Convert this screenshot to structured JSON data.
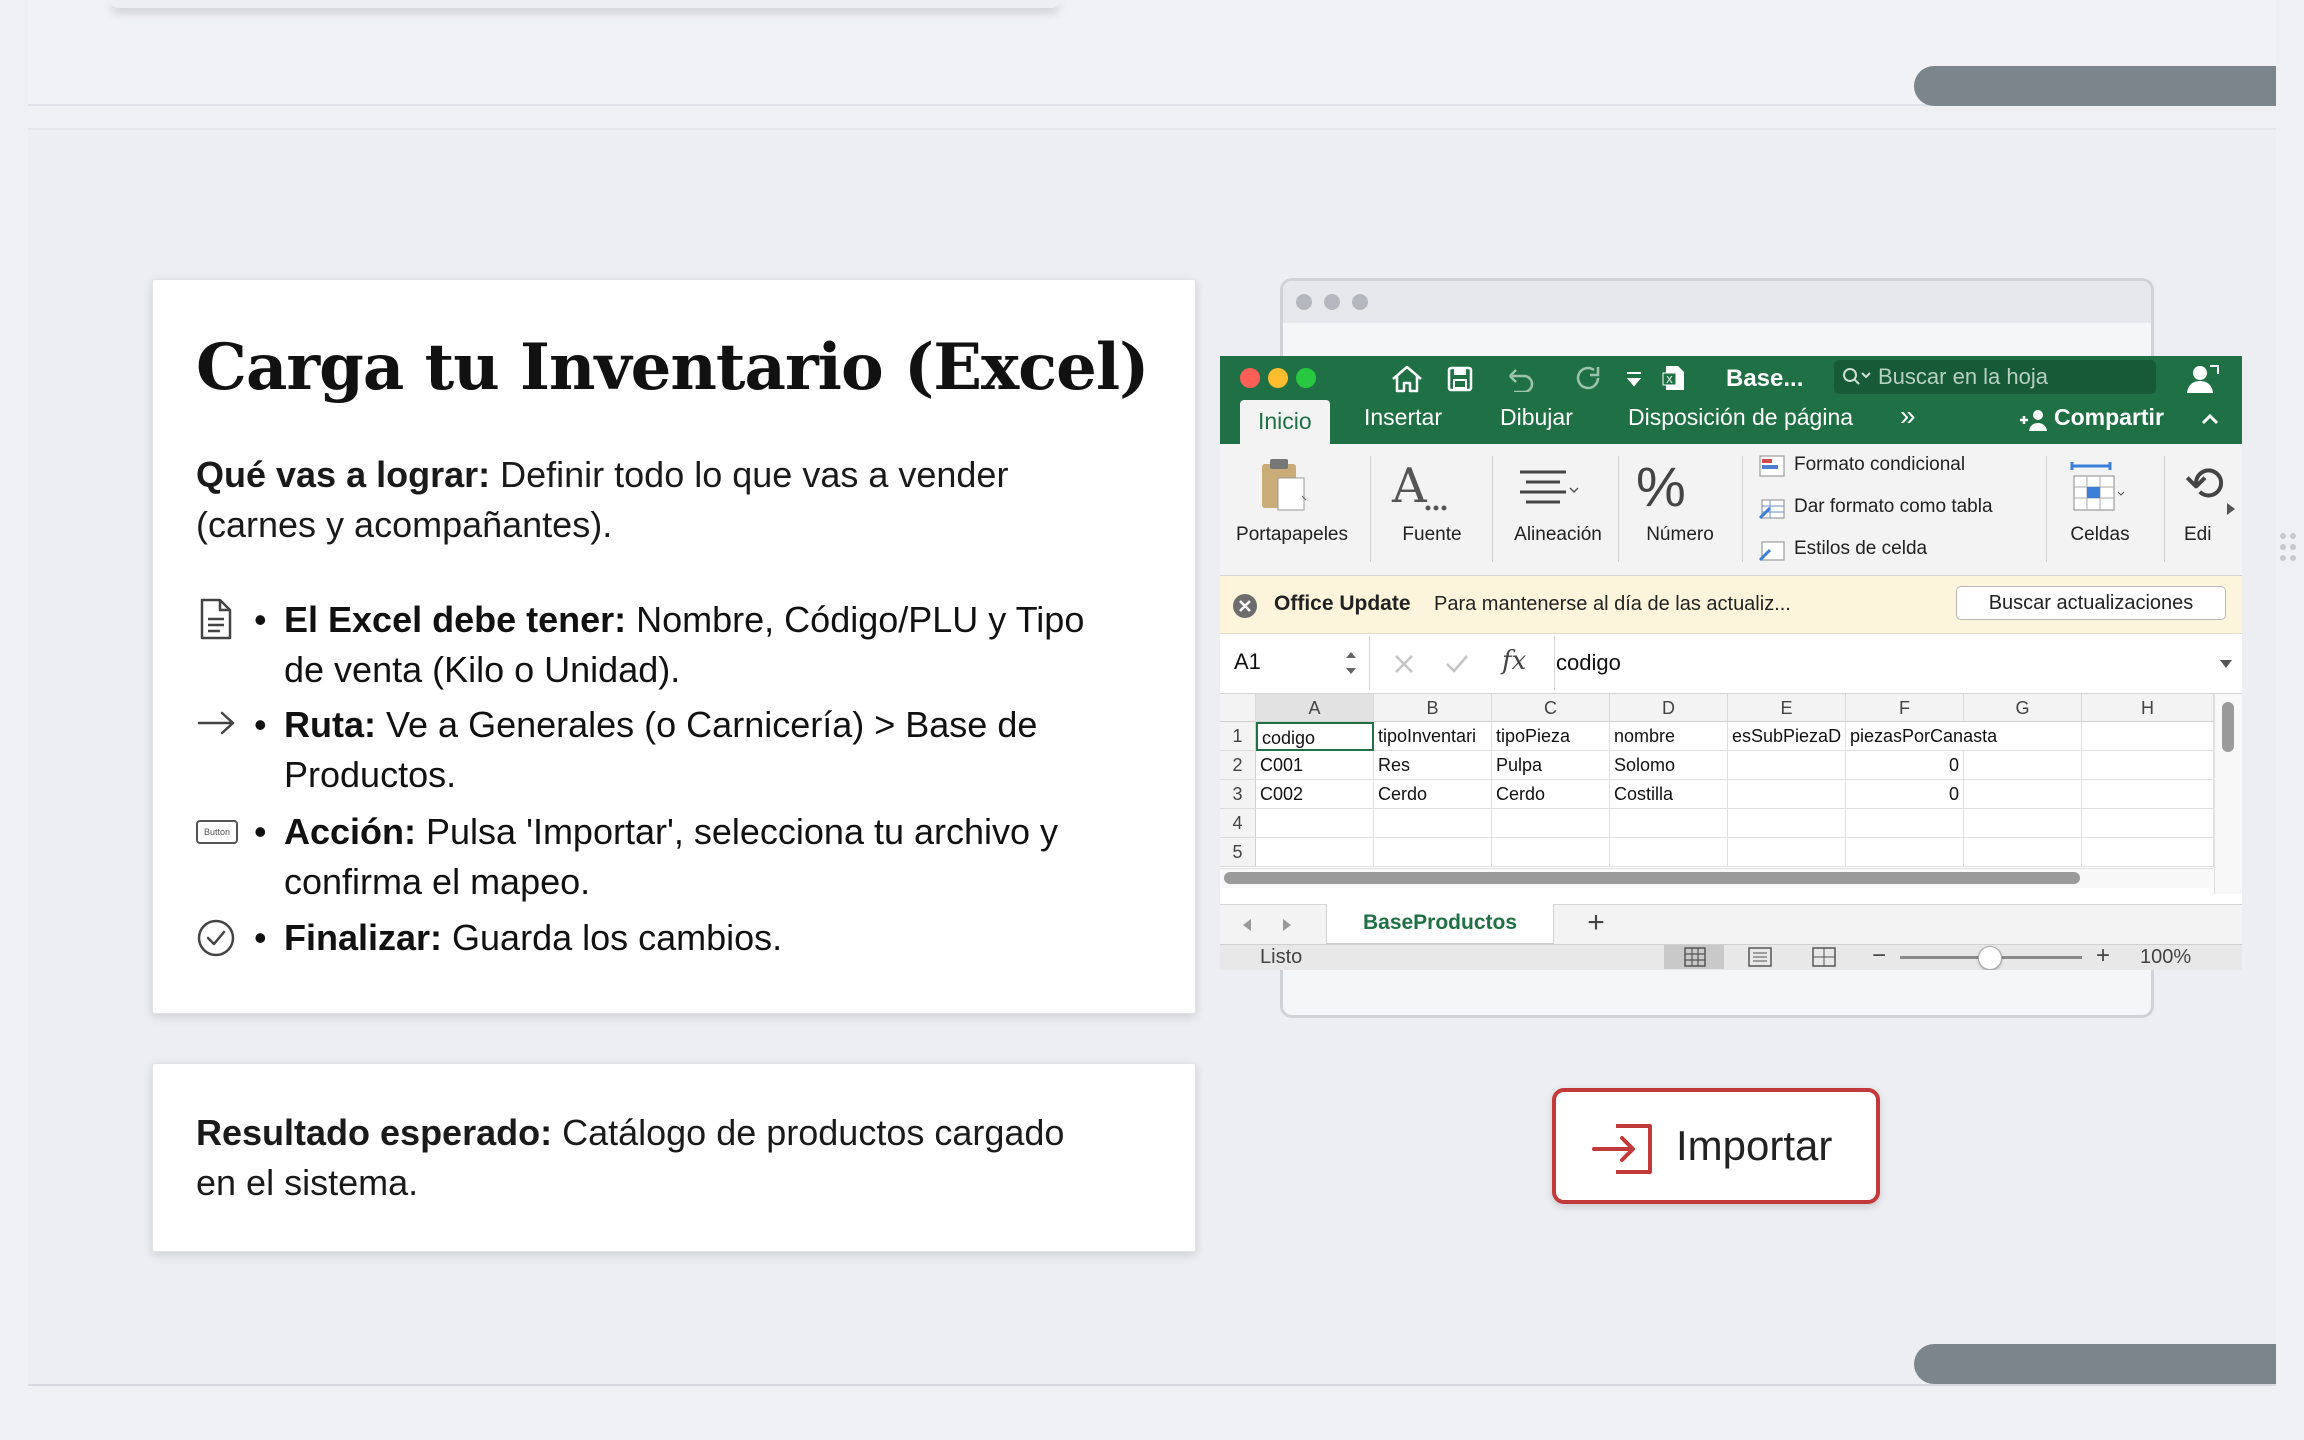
{
  "card": {
    "title": "Carga tu Inventario (Excel)",
    "intro_bold": "Qué vas a lograr:",
    "intro_text_1": " Definir todo lo que vas a vender",
    "intro_text_2": "(carnes y acompañantes).",
    "bullets": [
      {
        "icon": "document-icon",
        "bold": "El Excel debe tener:",
        "line1": " Nombre, Código/PLU y Tipo",
        "line2": "de venta (Kilo o Unidad)."
      },
      {
        "icon": "arrow-right-icon",
        "bold": "Ruta:",
        "line1": " Ve a Generales (o Carnicería) > Base de",
        "line2": "Productos."
      },
      {
        "icon": "button-icon",
        "bold": "Acción:",
        "line1": " Pulsa 'Importar', selecciona tu archivo y",
        "line2": "confirma el mapeo."
      },
      {
        "icon": "check-circle-icon",
        "bold": "Finalizar:",
        "line1": " Guarda los cambios.",
        "line2": ""
      }
    ],
    "bullet_char": "•",
    "button_icon_text": "Button"
  },
  "result": {
    "bold": "Resultado esperado:",
    "line1": " Catálogo de productos cargado",
    "line2": "en el sistema."
  },
  "excel": {
    "doc_name": "Base...",
    "search_placeholder": "Buscar en la hoja",
    "tabs": [
      "Inicio",
      "Insertar",
      "Dibujar",
      "Disposición de página"
    ],
    "more_tabs": "»",
    "share": "Compartir",
    "ribbon": {
      "portapapeles": "Portapapeles",
      "fuente": "Fuente",
      "alineacion": "Alineación",
      "numero": "Número",
      "formato_condicional": "Formato condicional",
      "formato_tabla": "Dar formato como tabla",
      "estilos": "Estilos de celda",
      "celdas": "Celdas",
      "edicion": "Edi",
      "percent": "%"
    },
    "notice": {
      "title": "Office Update",
      "text": "Para mantenerse al día de las actualiz...",
      "button": "Buscar actualizaciones"
    },
    "name_box": "A1",
    "fx": "fx",
    "formula": "codigo",
    "columns": [
      "A",
      "B",
      "C",
      "D",
      "E",
      "F",
      "G",
      "H"
    ],
    "rows": [
      "1",
      "2",
      "3",
      "4",
      "5"
    ],
    "cells": [
      [
        "codigo",
        "tipoInventari",
        "tipoPieza",
        "nombre",
        "esSubPiezaD",
        "piezasPorCanasta",
        "",
        ""
      ],
      [
        "C001",
        "Res",
        "Pulpa",
        "Solomo",
        "",
        "0",
        "",
        ""
      ],
      [
        "C002",
        "Cerdo",
        "Cerdo",
        "Costilla",
        "",
        "0",
        "",
        ""
      ],
      [
        "",
        "",
        "",
        "",
        "",
        "",
        "",
        ""
      ],
      [
        "",
        "",
        "",
        "",
        "",
        "",
        "",
        ""
      ]
    ],
    "sheet_tab": "BaseProductos",
    "add_sheet": "+",
    "status": "Listo",
    "zoom": "100%",
    "zoom_minus": "−",
    "zoom_plus": "+"
  },
  "import_button": {
    "label": "Importar"
  },
  "colors": {
    "excel_green": "#1f7145",
    "import_red": "#c23a3a",
    "pill_gray": "#7c858c"
  }
}
